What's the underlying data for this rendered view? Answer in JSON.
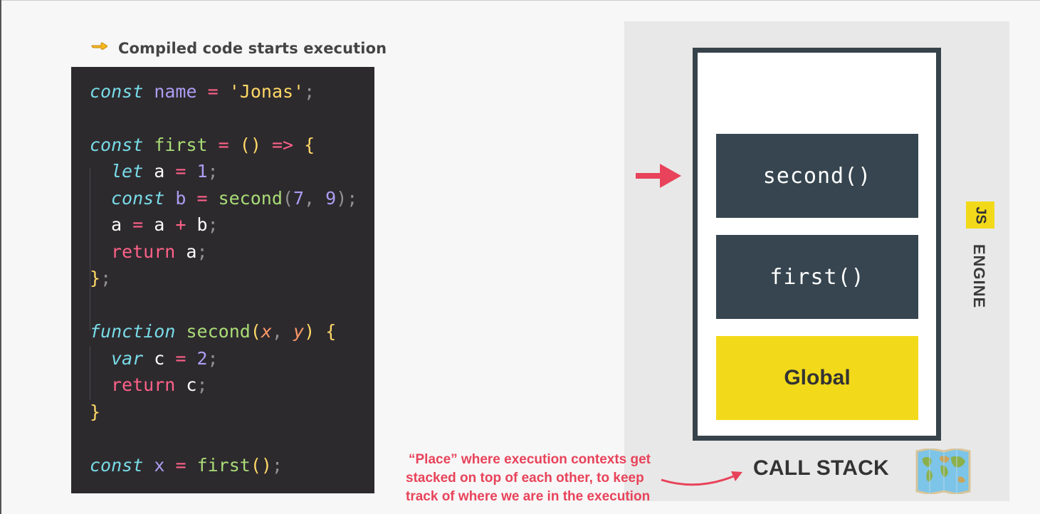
{
  "header": {
    "bullet_text": "Compiled code starts execution"
  },
  "code": {
    "l1": {
      "kw": "const",
      "name": "name",
      "op": "=",
      "str": "'Jonas'",
      "end": ";"
    },
    "l2": {
      "kw": "const",
      "name": "first",
      "op": "=",
      "paren": "()",
      "arrow": "=>",
      "brace": "{"
    },
    "l3": {
      "kw": "let",
      "id": "a",
      "op": "=",
      "num": "1",
      "end": ";"
    },
    "l4": {
      "kw": "const",
      "id": "b",
      "op": "=",
      "fn": "second",
      "open": "(",
      "n1": "7",
      "comma": ",",
      "n2": "9",
      "close": ")",
      "end": ";"
    },
    "l5": {
      "a1": "a",
      "op1": "=",
      "a2": "a",
      "op2": "+",
      "b": "b",
      "end": ";"
    },
    "l6": {
      "kw": "return",
      "id": "a",
      "end": ";"
    },
    "l7": {
      "brace": "}",
      "end": ";"
    },
    "l8": {
      "kw": "function",
      "fn": "second",
      "open": "(",
      "p1": "x",
      "comma": ",",
      "p2": "y",
      "close": ")",
      "brace": "{"
    },
    "l9": {
      "kw": "var",
      "id": "c",
      "op": "=",
      "num": "2",
      "end": ";"
    },
    "l10": {
      "kw": "return",
      "id": "c",
      "end": ";"
    },
    "l11": {
      "brace": "}"
    },
    "l12": {
      "kw": "const",
      "name": "x",
      "op": "=",
      "fn": "first",
      "paren": "()",
      "end": ";"
    }
  },
  "stack": {
    "items": [
      "second()",
      "first()",
      "Global"
    ],
    "label": "CALL STACK"
  },
  "engine": {
    "js_badge": "JS",
    "label": "ENGINE"
  },
  "note": {
    "lines": [
      "“Place” where execution contexts get",
      "stacked on top of each other, to keep",
      "track of where we are in the execution"
    ]
  },
  "colors": {
    "accent_red": "#e8435a",
    "js_yellow": "#f2da1a",
    "stack_dark": "#36454f",
    "code_bg": "#2d2a2e"
  },
  "icons": {
    "bullet": "pointing-hand-icon",
    "pointer": "right-arrow-icon",
    "map": "world-map-icon"
  }
}
